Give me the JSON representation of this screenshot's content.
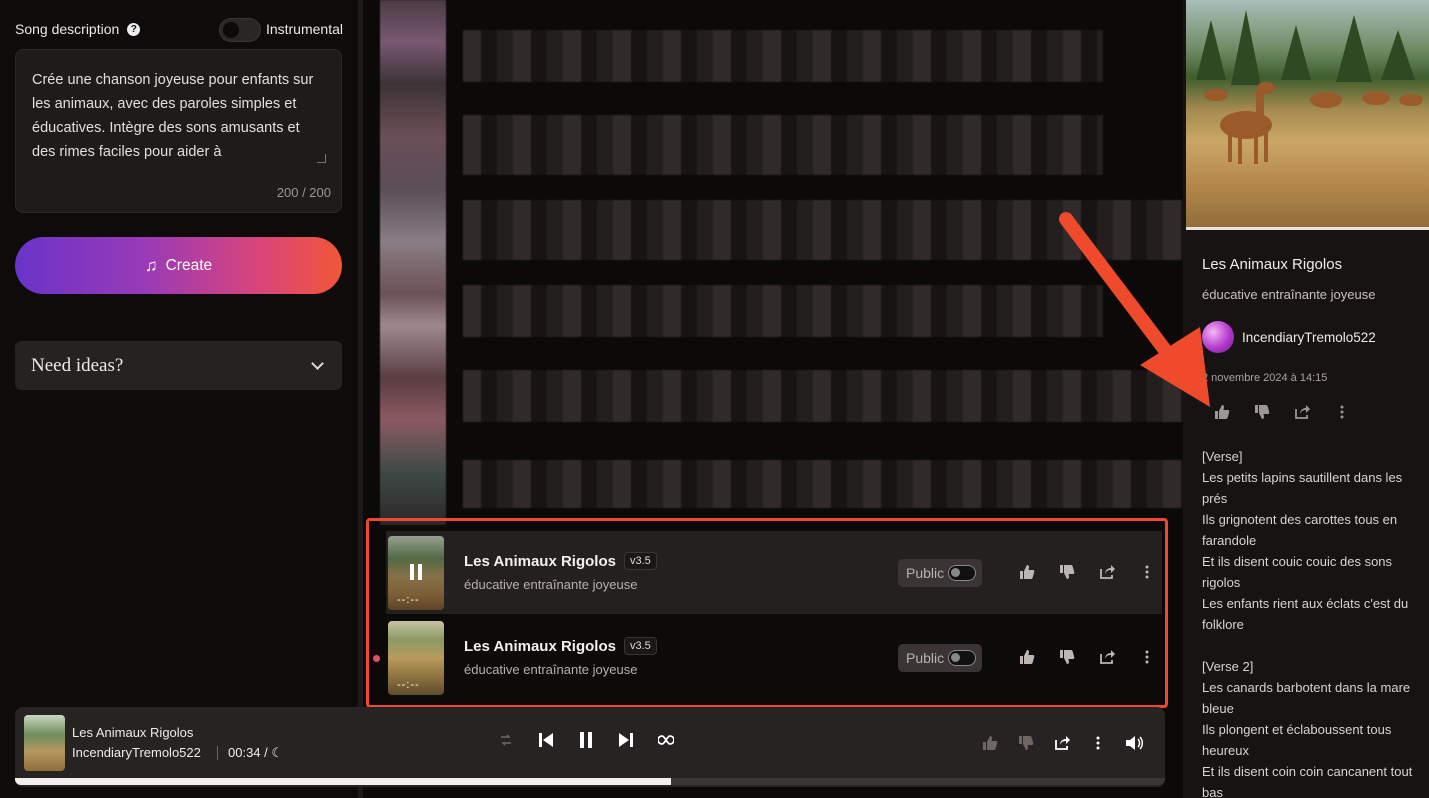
{
  "left_panel": {
    "description_label": "Song description",
    "help_glyph": "?",
    "instrumental_label": "Instrumental",
    "prompt_text": "Crée une chanson joyeuse pour enfants sur les animaux, avec des paroles simples et éducatives. Intègre des sons amusants et des rimes faciles pour aider à",
    "char_count": "200 / 200",
    "create_label": "Create",
    "ideas_label": "Need ideas?"
  },
  "song_list": {
    "rows": [
      {
        "title": "Les Animaux Rigolos",
        "version": "v3.5",
        "tags": "éducative entraînante joyeuse",
        "duration": "--:--",
        "public_label": "Public",
        "playing": true
      },
      {
        "title": "Les Animaux Rigolos",
        "version": "v3.5",
        "tags": "éducative entraînante joyeuse",
        "duration": "--:--",
        "public_label": "Public",
        "playing": false
      }
    ]
  },
  "detail_panel": {
    "title": "Les Animaux Rigolos",
    "tags": "éducative entraînante joyeuse",
    "user": "IncendiaryTremolo522",
    "date": "2 novembre 2024 à 14:15",
    "lyrics": [
      "[Verse]",
      "Les petits lapins sautillent dans les prés",
      "Ils grignotent des carottes tous en farandole",
      "Et ils disent couic couic des sons rigolos",
      "Les enfants rient aux éclats c'est du folklore",
      "",
      "[Verse 2]",
      "Les canards barbotent dans la mare bleue",
      "Ils plongent et éclaboussent tous heureux",
      "Et ils disent coin coin cancanent tout bas"
    ]
  },
  "player": {
    "title": "Les Animaux Rigolos",
    "user": "IncendiaryTremolo522",
    "time": "00:34 /",
    "progress": 0.57
  },
  "colors": {
    "accent_highlight": "#ef4a2b",
    "live_dot": "#e74b6c",
    "create_gradient_start": "#6a33c9",
    "create_gradient_end": "#f25636"
  },
  "icons": {
    "like": "thumbs-up-icon",
    "dislike": "thumbs-down-icon",
    "share": "share-icon",
    "more": "more-vertical-icon"
  }
}
